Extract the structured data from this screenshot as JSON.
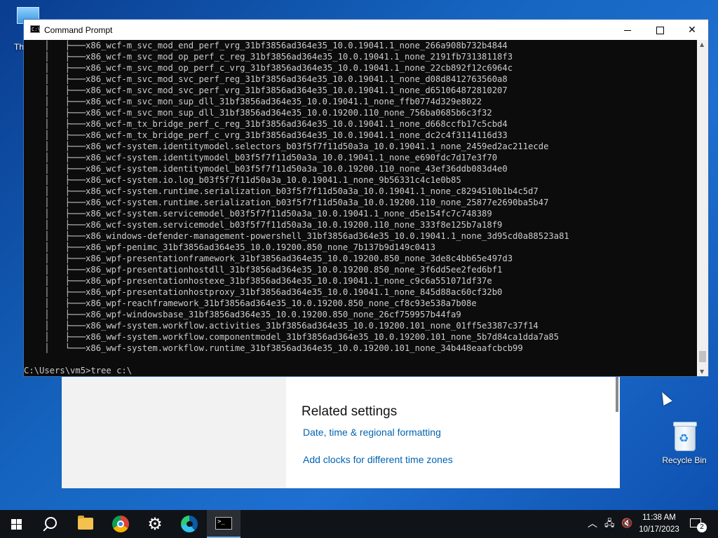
{
  "desktop": {
    "this_pc_label": "Th",
    "recycle_bin_label": "Recycle Bin"
  },
  "settings_window": {
    "related_title": "Related settings",
    "links": [
      "Date, time & regional formatting",
      "Add clocks for different time zones"
    ]
  },
  "cmd_window": {
    "title": "Command Prompt",
    "controls": {
      "minimize": "",
      "maximize": "",
      "close": "✕"
    },
    "lines": [
      "    │   ├───x86_wcf-m_svc_mod_end_perf_vrg_31bf3856ad364e35_10.0.19041.1_none_266a908b732b4844",
      "    │   ├───x86_wcf-m_svc_mod_op_perf_c_reg_31bf3856ad364e35_10.0.19041.1_none_2191fb73138118f3",
      "    │   ├───x86_wcf-m_svc_mod_op_perf_c_vrg_31bf3856ad364e35_10.0.19041.1_none_22cb892f12c6964c",
      "    │   ├───x86_wcf-m_svc_mod_svc_perf_reg_31bf3856ad364e35_10.0.19041.1_none_d08d8412763560a8",
      "    │   ├───x86_wcf-m_svc_mod_svc_perf_vrg_31bf3856ad364e35_10.0.19041.1_none_d651064872810207",
      "    │   ├───x86_wcf-m_svc_mon_sup_dll_31bf3856ad364e35_10.0.19041.1_none_ffb0774d329e8022",
      "    │   ├───x86_wcf-m_svc_mon_sup_dll_31bf3856ad364e35_10.0.19200.110_none_756ba0685b6c3f32",
      "    │   ├───x86_wcf-m_tx_bridge_perf_c_reg_31bf3856ad364e35_10.0.19041.1_none_d668ccfb17c5cbd4",
      "    │   ├───x86_wcf-m_tx_bridge_perf_c_vrg_31bf3856ad364e35_10.0.19041.1_none_dc2c4f3114116d33",
      "    │   ├───x86_wcf-system.identitymodel.selectors_b03f5f7f11d50a3a_10.0.19041.1_none_2459ed2ac211ecde",
      "    │   ├───x86_wcf-system.identitymodel_b03f5f7f11d50a3a_10.0.19041.1_none_e690fdc7d17e3f70",
      "    │   ├───x86_wcf-system.identitymodel_b03f5f7f11d50a3a_10.0.19200.110_none_43ef36ddb083d4e0",
      "    │   ├───x86_wcf-system.io.log_b03f5f7f11d50a3a_10.0.19041.1_none_9b56331c4c1e0b85",
      "    │   ├───x86_wcf-system.runtime.serialization_b03f5f7f11d50a3a_10.0.19041.1_none_c8294510b1b4c5d7",
      "    │   ├───x86_wcf-system.runtime.serialization_b03f5f7f11d50a3a_10.0.19200.110_none_25877e2690ba5b47",
      "    │   ├───x86_wcf-system.servicemodel_b03f5f7f11d50a3a_10.0.19041.1_none_d5e154fc7c748389",
      "    │   ├───x86_wcf-system.servicemodel_b03f5f7f11d50a3a_10.0.19200.110_none_333f8e125b7a18f9",
      "    │   ├───x86_windows-defender-management-powershell_31bf3856ad364e35_10.0.19041.1_none_3d95cd0a88523a81",
      "    │   ├───x86_wpf-penimc_31bf3856ad364e35_10.0.19200.850_none_7b137b9d149c0413",
      "    │   ├───x86_wpf-presentationframework_31bf3856ad364e35_10.0.19200.850_none_3de8c4bb65e497d3",
      "    │   ├───x86_wpf-presentationhostdll_31bf3856ad364e35_10.0.19200.850_none_3f6dd5ee2fed6bf1",
      "    │   ├───x86_wpf-presentationhostexe_31bf3856ad364e35_10.0.19041.1_none_c9c6a551071df37e",
      "    │   ├───x86_wpf-presentationhostproxy_31bf3856ad364e35_10.0.19041.1_none_845d88ac60cf32b0",
      "    │   ├───x86_wpf-reachframework_31bf3856ad364e35_10.0.19200.850_none_cf8c93e538a7b08e",
      "    │   ├───x86_wpf-windowsbase_31bf3856ad364e35_10.0.19200.850_none_26cf759957b44fa9",
      "    │   ├───x86_wwf-system.workflow.activities_31bf3856ad364e35_10.0.19200.101_none_01ff5e3387c37f14",
      "    │   ├───x86_wwf-system.workflow.componentmodel_31bf3856ad364e35_10.0.19200.101_none_5b7d84ca1dda7a85",
      "    │   └───x86_wwf-system.workflow.runtime_31bf3856ad364e35_10.0.19200.101_none_34b448eaafcbcb99",
      ""
    ],
    "prompt": "C:\\Users\\vm5>tree c:\\"
  },
  "taskbar": {
    "time": "11:38 AM",
    "date": "10/17/2023",
    "notification_count": "2",
    "apps": [
      "start-icon",
      "search-icon",
      "file-explorer-icon",
      "chrome-icon",
      "settings-icon",
      "edge-icon",
      "command-prompt-icon"
    ]
  }
}
